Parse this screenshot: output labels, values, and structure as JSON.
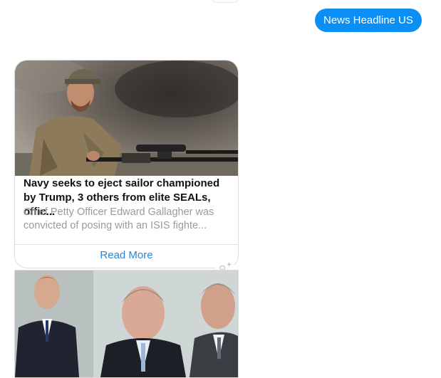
{
  "chat": {
    "sent_message": "News Headline US"
  },
  "news_cards": [
    {
      "title": "Navy seeks to eject sailor championed by Trump, 3 others from elite SEALs, offic...",
      "description": "Chief Petty Officer Edward Gallagher was convicted of posing with an ISIS fighte...",
      "action_label": "Read More"
    }
  ],
  "icons": {
    "reaction": "add-reaction-icon"
  }
}
